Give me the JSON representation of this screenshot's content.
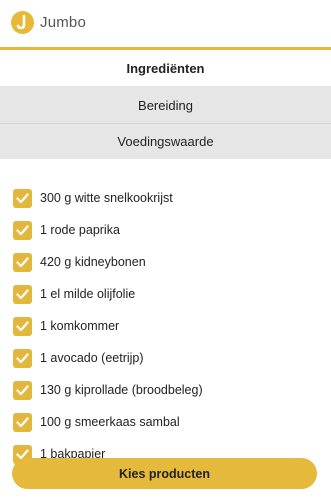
{
  "header": {
    "logo_icon": "jumbo-logo-icon",
    "brand": "Jumbo",
    "accent_color": "#e6b93a"
  },
  "tabs": [
    {
      "label": "Ingrediënten",
      "active": true
    },
    {
      "label": "Bereiding",
      "active": false
    },
    {
      "label": "Voedingswaarde",
      "active": false
    }
  ],
  "ingredients": [
    {
      "label": "300 g witte snelkookrijst",
      "checked": true
    },
    {
      "label": "1 rode paprika",
      "checked": true
    },
    {
      "label": "420 g kidneybonen",
      "checked": true
    },
    {
      "label": "1 el milde olijfolie",
      "checked": true
    },
    {
      "label": "1 komkommer",
      "checked": true
    },
    {
      "label": "1 avocado (eetrijp)",
      "checked": true
    },
    {
      "label": "130 g kiprollade (broodbeleg)",
      "checked": true
    },
    {
      "label": "100 g smeerkaas sambal",
      "checked": true
    },
    {
      "label": "1 bakpapier",
      "checked": true
    }
  ],
  "cta": {
    "label": "Kies producten",
    "color": "#e5b93b"
  },
  "icons": {
    "checkbox": "checkmark-icon"
  }
}
